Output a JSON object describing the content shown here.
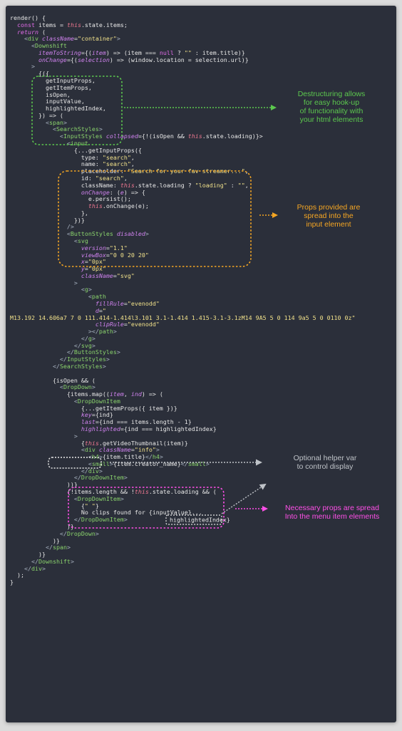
{
  "colors": {
    "background": "#2b2f3a",
    "plain": "#e8e8e8",
    "keyword": "#e06ce8",
    "attr": "#cf82ee",
    "string": "#f0e08a",
    "tag": "#8ad36c",
    "punct": "#a9b4c2",
    "this": "#f07891",
    "callout_green": "#5cc84e",
    "callout_orange": "#f5a623",
    "callout_gray": "#bfc3c8",
    "callout_magenta": "#ff4fe8"
  },
  "code_lines": [
    [
      [
        "render() {",
        "p"
      ]
    ],
    [
      [
        "  ",
        "p"
      ],
      [
        "const",
        "k"
      ],
      [
        " items = ",
        "p"
      ],
      [
        "this",
        "t"
      ],
      [
        ".state.items;",
        "p"
      ]
    ],
    [
      [
        "  ",
        "p"
      ],
      [
        "return",
        "ki"
      ],
      [
        " (",
        "p"
      ]
    ],
    [
      [
        "    <",
        "u"
      ],
      [
        "div",
        "g"
      ],
      [
        " ",
        "p"
      ],
      [
        "className",
        "ai"
      ],
      [
        "=",
        "p"
      ],
      [
        "\"container\"",
        "s"
      ],
      [
        ">",
        "u"
      ]
    ],
    [
      [
        "      <",
        "u"
      ],
      [
        "Downshift",
        "g"
      ]
    ],
    [
      [
        "        ",
        "p"
      ],
      [
        "itemToString",
        "ai"
      ],
      [
        "={(",
        "p"
      ],
      [
        "item",
        "ai"
      ],
      [
        ") => (item === ",
        "p"
      ],
      [
        "null",
        "k"
      ],
      [
        " ? ",
        "p"
      ],
      [
        "\"\"",
        "s"
      ],
      [
        " : item.title)}",
        "p"
      ]
    ],
    [
      [
        "        ",
        "p"
      ],
      [
        "onChange",
        "ai"
      ],
      [
        "={(",
        "p"
      ],
      [
        "selection",
        "ai"
      ],
      [
        ") => (window.location = selection.url)}",
        "p"
      ]
    ],
    [
      [
        "      >",
        "u"
      ]
    ],
    [
      [
        "        {({",
        "p"
      ]
    ],
    [
      [
        "          getInputProps,",
        "p"
      ]
    ],
    [
      [
        "          getItemProps,",
        "p"
      ]
    ],
    [
      [
        "          isOpen,",
        "p"
      ]
    ],
    [
      [
        "          inputValue,",
        "p"
      ]
    ],
    [
      [
        "          highlightedIndex,",
        "p"
      ]
    ],
    [
      [
        "        }) => (",
        "p"
      ]
    ],
    [
      [
        "          <",
        "u"
      ],
      [
        "span",
        "g"
      ],
      [
        ">",
        "u"
      ]
    ],
    [
      [
        "            <",
        "u"
      ],
      [
        "SearchStyles",
        "g"
      ],
      [
        ">",
        "u"
      ]
    ],
    [
      [
        "              <",
        "u"
      ],
      [
        "InputStyles",
        "g"
      ],
      [
        " ",
        "p"
      ],
      [
        "collapsed",
        "ai"
      ],
      [
        "={!(isOpen && ",
        "p"
      ],
      [
        "this",
        "t"
      ],
      [
        ".state.loading)}>",
        "p"
      ]
    ],
    [
      [
        "                <",
        "u"
      ],
      [
        "input",
        "g"
      ]
    ],
    [
      [
        "                  {...getInputProps({",
        "p"
      ]
    ],
    [
      [
        "                    type: ",
        "p"
      ],
      [
        "\"search\"",
        "s"
      ],
      [
        ",",
        "p"
      ]
    ],
    [
      [
        "                    name: ",
        "p"
      ],
      [
        "\"search\"",
        "s"
      ],
      [
        ",",
        "p"
      ]
    ],
    [
      [
        "                    placeholder: ",
        "p"
      ],
      [
        "\"Search for your fav streamer...\"",
        "s"
      ],
      [
        ",",
        "p"
      ]
    ],
    [
      [
        "                    id: ",
        "p"
      ],
      [
        "\"search\"",
        "s"
      ],
      [
        ",",
        "p"
      ]
    ],
    [
      [
        "                    className: ",
        "p"
      ],
      [
        "this",
        "t"
      ],
      [
        ".state.loading ? ",
        "p"
      ],
      [
        "\"loading\"",
        "s"
      ],
      [
        " : ",
        "p"
      ],
      [
        "\"\"",
        "s"
      ],
      [
        ",",
        "p"
      ]
    ],
    [
      [
        "                    ",
        "p"
      ],
      [
        "onChange",
        "ai"
      ],
      [
        ": (",
        "p"
      ],
      [
        "e",
        "ai"
      ],
      [
        ") => {",
        "p"
      ]
    ],
    [
      [
        "                      e.persist();",
        "p"
      ]
    ],
    [
      [
        "                      ",
        "p"
      ],
      [
        "this",
        "t"
      ],
      [
        ".onChange(e);",
        "p"
      ]
    ],
    [
      [
        "                    },",
        "p"
      ]
    ],
    [
      [
        "                  })}",
        "p"
      ]
    ],
    [
      [
        "                />",
        "u"
      ]
    ],
    [
      [
        "                <",
        "u"
      ],
      [
        "ButtonStyles",
        "g"
      ],
      [
        " ",
        "p"
      ],
      [
        "disabled",
        "ai"
      ],
      [
        ">",
        "u"
      ]
    ],
    [
      [
        "                  <",
        "u"
      ],
      [
        "svg",
        "g"
      ]
    ],
    [
      [
        "                    ",
        "p"
      ],
      [
        "version",
        "ai"
      ],
      [
        "=",
        "p"
      ],
      [
        "\"1.1\"",
        "s"
      ]
    ],
    [
      [
        "                    ",
        "p"
      ],
      [
        "viewBox",
        "ai"
      ],
      [
        "=",
        "p"
      ],
      [
        "\"0 0 20 20\"",
        "s"
      ]
    ],
    [
      [
        "                    ",
        "p"
      ],
      [
        "x",
        "ai"
      ],
      [
        "=",
        "p"
      ],
      [
        "\"0px\"",
        "s"
      ]
    ],
    [
      [
        "                    ",
        "p"
      ],
      [
        "y",
        "ai"
      ],
      [
        "=",
        "p"
      ],
      [
        "\"0px\"",
        "s"
      ]
    ],
    [
      [
        "                    ",
        "p"
      ],
      [
        "className",
        "ai"
      ],
      [
        "=",
        "p"
      ],
      [
        "\"svg\"",
        "s"
      ]
    ],
    [
      [
        "                  >",
        "u"
      ]
    ],
    [
      [
        "                    <",
        "u"
      ],
      [
        "g",
        "g"
      ],
      [
        ">",
        "u"
      ]
    ],
    [
      [
        "                      <",
        "u"
      ],
      [
        "path",
        "g"
      ]
    ],
    [
      [
        "                        ",
        "p"
      ],
      [
        "fillRule",
        "ai"
      ],
      [
        "=",
        "p"
      ],
      [
        "\"evenodd\"",
        "s"
      ]
    ],
    [
      [
        "                        ",
        "p"
      ],
      [
        "d",
        "ai"
      ],
      [
        "=",
        "p"
      ],
      [
        "\"",
        "s"
      ]
    ],
    [
      [
        "M13.192 14.606a7 7 0 111.414-1.414l3.101 3.1-1.414 1.415-3.1-3.1zM14 9A5 5 0 114 9a5 5 0 0110 0z\"",
        "s"
      ]
    ],
    [
      [
        "                        ",
        "p"
      ],
      [
        "clipRule",
        "ai"
      ],
      [
        "=",
        "p"
      ],
      [
        "\"evenodd\"",
        "s"
      ]
    ],
    [
      [
        "                      ></",
        "u"
      ],
      [
        "path",
        "g"
      ],
      [
        ">",
        "u"
      ]
    ],
    [
      [
        "                    </",
        "u"
      ],
      [
        "g",
        "g"
      ],
      [
        ">",
        "u"
      ]
    ],
    [
      [
        "                  </",
        "u"
      ],
      [
        "svg",
        "g"
      ],
      [
        ">",
        "u"
      ]
    ],
    [
      [
        "                </",
        "u"
      ],
      [
        "ButtonStyles",
        "g"
      ],
      [
        ">",
        "u"
      ]
    ],
    [
      [
        "              </",
        "u"
      ],
      [
        "InputStyles",
        "g"
      ],
      [
        ">",
        "u"
      ]
    ],
    [
      [
        "            </",
        "u"
      ],
      [
        "SearchStyles",
        "g"
      ],
      [
        ">",
        "u"
      ]
    ],
    [
      [
        "",
        "p"
      ]
    ],
    [
      [
        "            {isOpen && (",
        "p"
      ]
    ],
    [
      [
        "              <",
        "u"
      ],
      [
        "DropDown",
        "g"
      ],
      [
        ">",
        "u"
      ]
    ],
    [
      [
        "                {items.map((",
        "p"
      ],
      [
        "item",
        "ai"
      ],
      [
        ", ",
        "p"
      ],
      [
        "ind",
        "ai"
      ],
      [
        ") => (",
        "p"
      ]
    ],
    [
      [
        "                  <",
        "u"
      ],
      [
        "DropDownItem",
        "g"
      ]
    ],
    [
      [
        "                    {...getItemProps({ item })}",
        "p"
      ]
    ],
    [
      [
        "                    ",
        "p"
      ],
      [
        "key",
        "ai"
      ],
      [
        "={ind}",
        "p"
      ]
    ],
    [
      [
        "                    ",
        "p"
      ],
      [
        "last",
        "ai"
      ],
      [
        "={ind === items.length - 1}",
        "p"
      ]
    ],
    [
      [
        "                    ",
        "p"
      ],
      [
        "highlighted",
        "ai"
      ],
      [
        "={ind === highlightedIndex}",
        "p"
      ]
    ],
    [
      [
        "                  >",
        "u"
      ]
    ],
    [
      [
        "                    {",
        "p"
      ],
      [
        "this",
        "t"
      ],
      [
        ".getVideoThumbnail(item)}",
        "p"
      ]
    ],
    [
      [
        "                    <",
        "u"
      ],
      [
        "div",
        "g"
      ],
      [
        " ",
        "p"
      ],
      [
        "className",
        "ai"
      ],
      [
        "=",
        "p"
      ],
      [
        "\"info\"",
        "s"
      ],
      [
        ">",
        "u"
      ]
    ],
    [
      [
        "                      <",
        "u"
      ],
      [
        "h4",
        "g"
      ],
      [
        ">",
        "u"
      ],
      [
        "{item.title}",
        "p"
      ],
      [
        "</",
        "u"
      ],
      [
        "h4",
        "g"
      ],
      [
        ">",
        "u"
      ]
    ],
    [
      [
        "                      <",
        "u"
      ],
      [
        "small",
        "g"
      ],
      [
        ">",
        "u"
      ],
      [
        "{item.creator_name}",
        "p"
      ],
      [
        "</",
        "u"
      ],
      [
        "small",
        "g"
      ],
      [
        ">",
        "u"
      ]
    ],
    [
      [
        "                    </",
        "u"
      ],
      [
        "div",
        "g"
      ],
      [
        ">",
        "u"
      ]
    ],
    [
      [
        "                  </",
        "u"
      ],
      [
        "DropDownItem",
        "g"
      ],
      [
        ">",
        "u"
      ]
    ],
    [
      [
        "                ))}",
        "p"
      ]
    ],
    [
      [
        "                {!items.length && !",
        "p"
      ],
      [
        "this",
        "t"
      ],
      [
        ".state.loading && (",
        "p"
      ]
    ],
    [
      [
        "                  <",
        "u"
      ],
      [
        "DropDownItem",
        "g"
      ],
      [
        ">",
        "u"
      ]
    ],
    [
      [
        "                    {",
        "p"
      ],
      [
        "\" \"",
        "s"
      ],
      [
        "}",
        "p"
      ]
    ],
    [
      [
        "                    No clips found for {inputValue}...",
        "p"
      ]
    ],
    [
      [
        "                  </",
        "u"
      ],
      [
        "DropDownItem",
        "g"
      ],
      [
        ">",
        "u"
      ]
    ],
    [
      [
        "                )}",
        "p"
      ]
    ],
    [
      [
        "              </",
        "u"
      ],
      [
        "DropDown",
        "g"
      ],
      [
        ">",
        "u"
      ]
    ],
    [
      [
        "            )}",
        "p"
      ]
    ],
    [
      [
        "          </",
        "u"
      ],
      [
        "span",
        "g"
      ],
      [
        ">",
        "u"
      ]
    ],
    [
      [
        "        )}",
        "p"
      ]
    ],
    [
      [
        "      </",
        "u"
      ],
      [
        "Downshift",
        "g"
      ],
      [
        ">",
        "u"
      ]
    ],
    [
      [
        "    </",
        "u"
      ],
      [
        "div",
        "g"
      ],
      [
        ">",
        "u"
      ]
    ],
    [
      [
        "  );",
        "p"
      ]
    ],
    [
      [
        "}",
        "p"
      ]
    ]
  ],
  "callouts": {
    "destructuring": "Destructuring allows\nfor easy hook-up\nof functionality with\nyour html elements",
    "props_input": "Props provided are\nspread into the\ninput element",
    "helper_var": "Optional helper var\nto control display",
    "menu_props": "Necessary props are spread\nInto the menu item elements"
  }
}
